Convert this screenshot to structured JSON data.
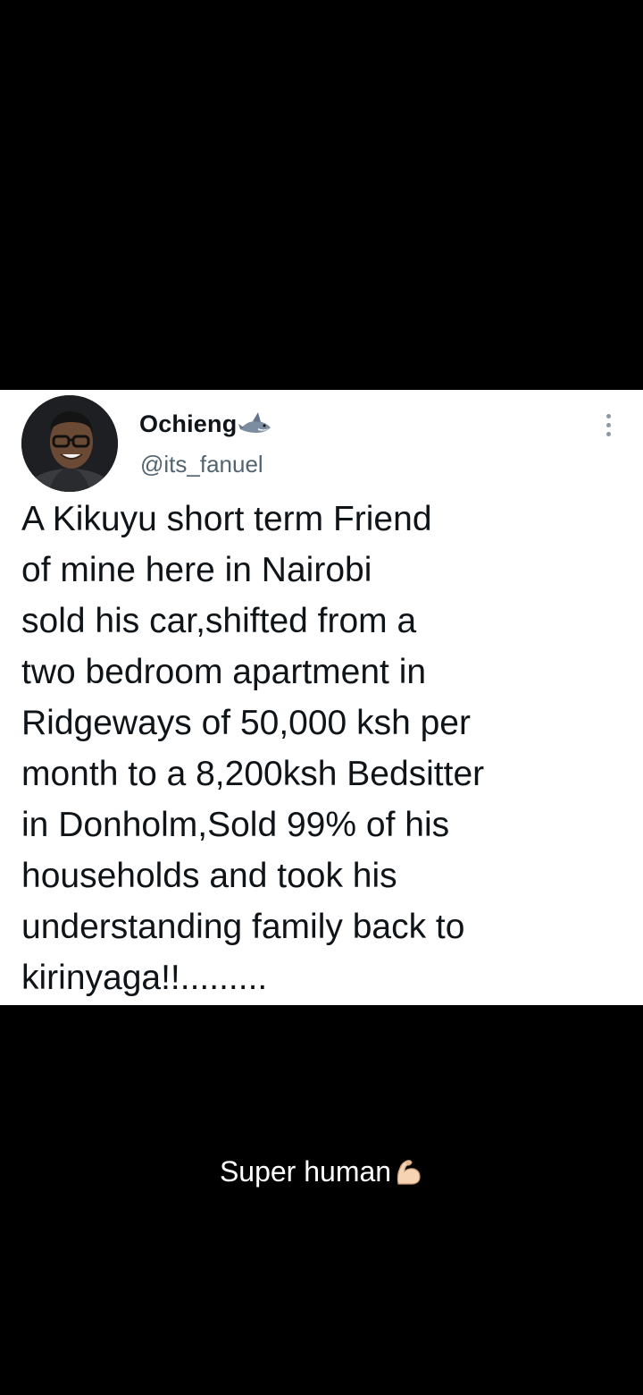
{
  "tweet": {
    "display_name": "Ochieng",
    "name_emoji": "shark-icon",
    "handle": "@its_fanuel",
    "text_lines": [
      "A Kikuyu short term Friend",
      "of mine here in Nairobi",
      "sold his car,shifted from a",
      "two bedroom apartment in",
      "Ridgeways of 50,000 ksh per",
      "month to a 8,200ksh Bedsitter",
      "in Donholm,Sold 99% of his",
      "households and took his",
      "understanding family back to",
      "kirinyaga!!........."
    ]
  },
  "caption": {
    "text": "Super human",
    "emoji": "flexed-biceps-icon"
  },
  "colors": {
    "background": "#000000",
    "card": "#ffffff",
    "text_primary": "#0f1419",
    "text_secondary": "#536471",
    "caption_text": "#ffffff"
  }
}
